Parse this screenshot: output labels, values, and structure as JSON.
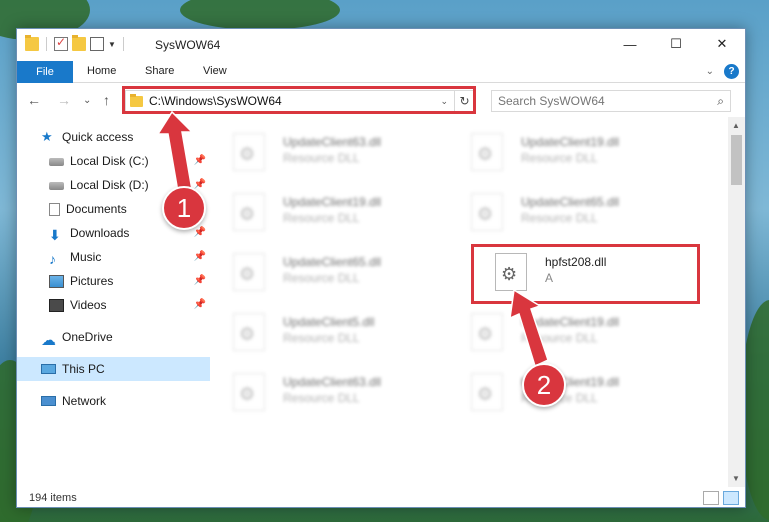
{
  "window": {
    "title": "SysWOW64",
    "minimize": "—",
    "maximize": "☐",
    "close": "✕"
  },
  "ribbon": {
    "file": "File",
    "tabs": [
      "Home",
      "Share",
      "View"
    ],
    "help": "?",
    "collapse": "⌄"
  },
  "nav": {
    "back": "←",
    "forward": "→",
    "recent": "⌄",
    "up": "↑",
    "address": "C:\\Windows\\SysWOW64",
    "address_dropdown": "⌄",
    "refresh": "↻",
    "search_placeholder": "Search SysWOW64",
    "search_icon": "⌕"
  },
  "sidebar": {
    "items": [
      {
        "label": "Quick access",
        "icon": "star-icon"
      },
      {
        "label": "Local Disk (C:)",
        "icon": "disk-icon",
        "pinned": true
      },
      {
        "label": "Local Disk (D:)",
        "icon": "disk-icon",
        "pinned": true
      },
      {
        "label": "Documents",
        "icon": "documents-icon",
        "pinned": true
      },
      {
        "label": "Downloads",
        "icon": "download-icon",
        "pinned": true
      },
      {
        "label": "Music",
        "icon": "music-icon",
        "pinned": true
      },
      {
        "label": "Pictures",
        "icon": "pictures-icon",
        "pinned": true
      },
      {
        "label": "Videos",
        "icon": "videos-icon",
        "pinned": true
      },
      {
        "label": "OneDrive",
        "icon": "cloud-icon"
      },
      {
        "label": "This PC",
        "icon": "computer-icon",
        "selected": true
      },
      {
        "label": "Network",
        "icon": "network-icon"
      }
    ],
    "pin_glyph": "📌"
  },
  "files": [
    {
      "name": "UpdateClient63.dll",
      "type": "Resource DLL"
    },
    {
      "name": "UpdateClient19.dll",
      "type": "Resource DLL"
    },
    {
      "name": "UpdateClient19.dll",
      "type": "Resource DLL"
    },
    {
      "name": "UpdateClient65.dll",
      "type": "Resource DLL"
    },
    {
      "name": "UpdateClient65.dll",
      "type": "Resource DLL"
    },
    {
      "name": "hpfst208.dll",
      "type": "A"
    },
    {
      "name": "UpdateClient5.dll",
      "type": "Resource DLL"
    },
    {
      "name": "UpdateClient19.dll",
      "type": "Resource DLL"
    },
    {
      "name": "UpdateClient63.dll",
      "type": "Resource DLL"
    },
    {
      "name": "UpdateClient19.dll",
      "type": "Resource DLL"
    }
  ],
  "status": {
    "count": "194 items"
  },
  "annotations": {
    "badge1": "1",
    "badge2": "2",
    "color": "#d9363e"
  },
  "scroll": {
    "up": "▲",
    "down": "▼"
  }
}
